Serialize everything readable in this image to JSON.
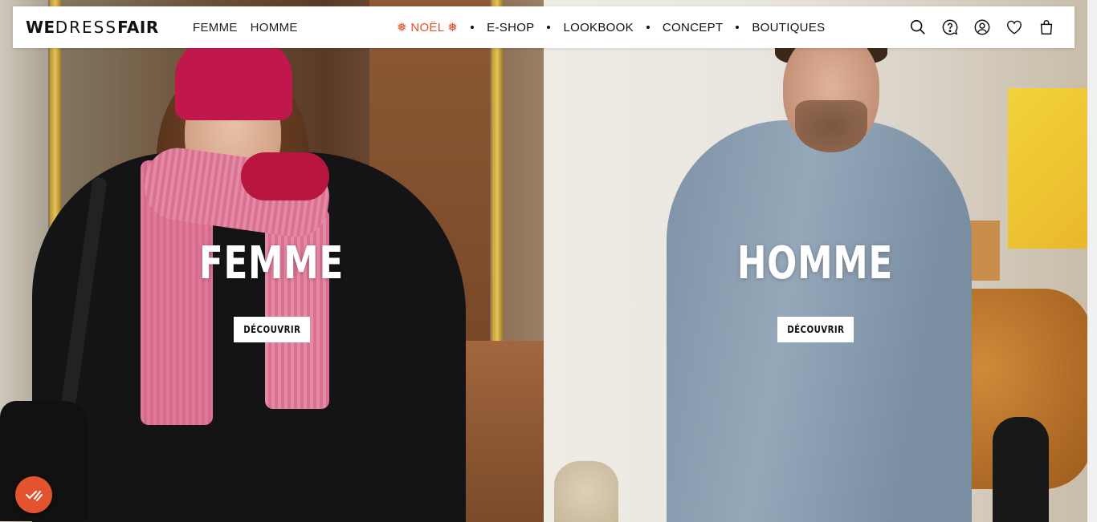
{
  "brand": {
    "logo_text_1": "WE",
    "logo_text_2": "DRESS",
    "logo_text_3": "FAIR"
  },
  "nav": {
    "gender": [
      "FEMME",
      "HOMME"
    ],
    "main": [
      {
        "label": "❅ NOËL ❅",
        "highlight": true
      },
      {
        "label": "E-SHOP"
      },
      {
        "label": "LOOKBOOK"
      },
      {
        "label": "CONCEPT"
      },
      {
        "label": "BOUTIQUES"
      }
    ],
    "accent_color": "#e3532f"
  },
  "icons": [
    "search-icon",
    "help-icon",
    "account-icon",
    "wishlist-icon",
    "cart-icon"
  ],
  "hero": {
    "left": {
      "title": "FEMME",
      "cta": "DÉCOUVRIR"
    },
    "right": {
      "title": "HOMME",
      "cta": "DÉCOUVRIR"
    }
  },
  "badge": {
    "icon": "accessibility-badge-icon",
    "color": "#e3532f"
  }
}
